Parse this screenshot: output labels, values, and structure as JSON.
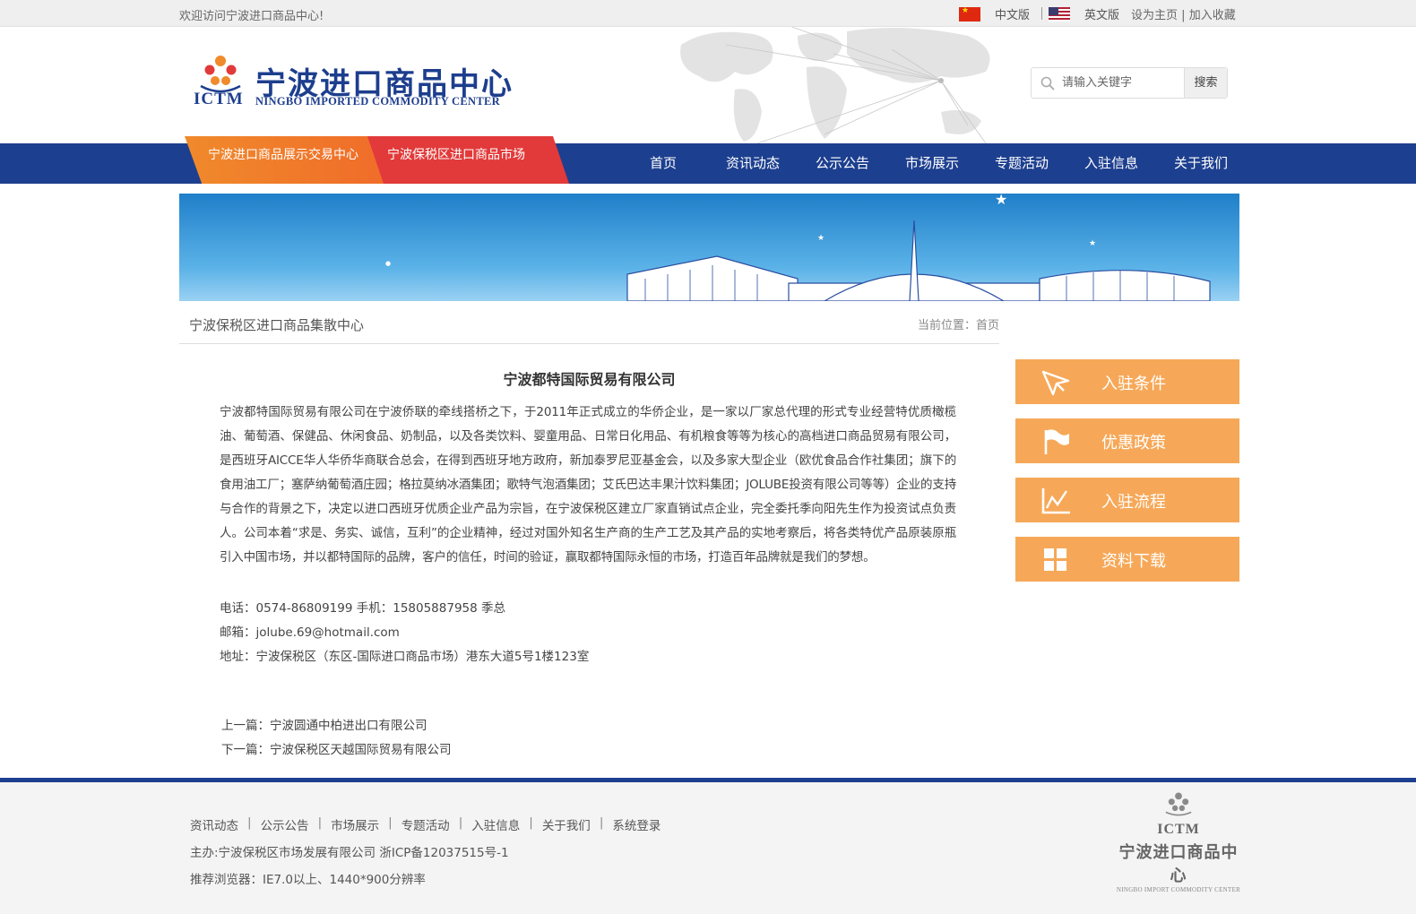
{
  "topbar": {
    "welcome": "欢迎访问宁波进口商品中心!",
    "lang_cn": "中文版",
    "lang_en": "英文版",
    "set_home": "设为主页",
    "link_sep": "|",
    "add_fav": "加入收藏"
  },
  "header": {
    "logo_abbr": "ICTM",
    "logo_cn": "宁波进口商品中心",
    "logo_en": "NINGBO IMPORTED COMMODITY CENTER",
    "search_placeholder": "请输入关键字",
    "search_button": "搜索"
  },
  "nav": {
    "tab_orange": "宁波进口商品展示交易中心",
    "tab_red": "宁波保税区进口商品市场",
    "items": [
      "首页",
      "资讯动态",
      "公示公告",
      "市场展示",
      "专题活动",
      "入驻信息",
      "关于我们"
    ]
  },
  "content": {
    "section_title": "宁波保税区进口商品集散中心",
    "location": "当前位置：首页",
    "article_title": "宁波都特国际贸易有限公司",
    "article_body": "宁波都特国际贸易有限公司在宁波侨联的牵线搭桥之下，于2011年正式成立的华侨企业，是一家以厂家总代理的形式专业经营特优质橄榄油、葡萄酒、保健品、休闲食品、奶制品，以及各类饮料、婴童用品、日常日化用品、有机粮食等等为核心的高档进口商品贸易有限公司，是西班牙AICCE华人华侨华商联合总会，在得到西班牙地方政府，新加泰罗尼亚基金会，以及多家大型企业（欧优食品合作社集团；旗下的食用油工厂；塞萨纳葡萄酒庄园；格拉莫纳冰酒集团；歌特气泡酒集团；艾氏巴达丰果汁饮料集团；JOLUBE投资有限公司等等）企业的支持与合作的背景之下，决定以进口西班牙优质企业产品为宗旨，在宁波保税区建立厂家直销试点企业，完全委托季向阳先生作为投资试点负责人。公司本着“求是、务实、诚信，互利”的企业精神，经过对国外知名生产商的生产工艺及其产品的实地考察后，将各类特优产品原装原瓶引入中国市场，并以都特国际的品牌，客户的信任，时间的验证，赢取都特国际永恒的市场，打造百年品牌就是我们的梦想。",
    "phone_line": "电话：0574-86809199    手机：15805887958 季总",
    "email_line": "邮箱：jolube.69@hotmail.com",
    "address_line": "地址：宁波保税区（东区-国际进口商品市场）港东大道5号1楼123室",
    "prev": "上一篇：宁波圆通中柏进出口有限公司",
    "next": "下一篇：宁波保税区天越国际贸易有限公司"
  },
  "sidebar": {
    "buttons": [
      {
        "label": "入驻条件",
        "icon": "paper-plane-icon"
      },
      {
        "label": "优惠政策",
        "icon": "flag-icon"
      },
      {
        "label": "入驻流程",
        "icon": "chart-line-icon"
      },
      {
        "label": "资料下载",
        "icon": "grid-icon"
      }
    ]
  },
  "footer": {
    "links": [
      "资讯动态",
      "公示公告",
      "市场展示",
      "专题活动",
      "入驻信息",
      "关于我们",
      "系统登录"
    ],
    "link_divider": "|",
    "host": "主办:宁波保税区市场发展有限公司  浙ICP备12037515号-1",
    "browser": "推荐浏览器：IE7.0以上、1440*900分辨率",
    "logo_abbr": "ICTM",
    "logo_cn": "宁波进口商品中心",
    "logo_en": "NINGBO IMPORT COMMODITY CENTER"
  },
  "colors": {
    "nav_blue": "#1d3f8f",
    "tab_orange": "#f08a2b",
    "tab_red": "#e23a3a",
    "side_orange": "#f6a858"
  }
}
